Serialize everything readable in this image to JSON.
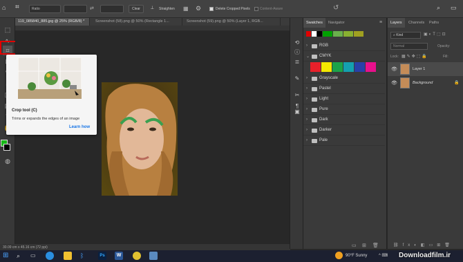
{
  "options_bar": {
    "ratio_label": "Ratio",
    "clear_label": "Clear",
    "straighten_label": "Straighten",
    "delete_cropped_label": "Delete Cropped Pixels",
    "content_aware_label": "Content-Aware"
  },
  "tabs": [
    {
      "label": "119_085840_885.jpg @ 25% (RGB/8) *",
      "active": true
    },
    {
      "label": "Screenshot (58).png @ 50% (Rectangle 1...",
      "active": false
    },
    {
      "label": "Screenshot (59).png @ 50% (Layer 1, RGB...",
      "active": false
    }
  ],
  "tooltip": {
    "title": "Crop tool (C)",
    "description": "Trims or expands the edges of an image",
    "link": "Learn how"
  },
  "status_bar": {
    "text": "30.09 cm x 45.16 cm (72 ppi)"
  },
  "swatches_panel": {
    "tabs": [
      "Swatches",
      "Navigator"
    ],
    "top_colors": [
      "#e00000",
      "#ffffff",
      "#000000",
      "#00a000",
      "#6ab04c",
      "#88b030",
      "#a0a020"
    ],
    "groups": [
      {
        "label": "RGB",
        "expanded": false
      },
      {
        "label": "CMYK",
        "expanded": true
      },
      {
        "label": "Grayscale",
        "expanded": false
      },
      {
        "label": "Pastel",
        "expanded": false
      },
      {
        "label": "Light",
        "expanded": false
      },
      {
        "label": "Pure",
        "expanded": false
      },
      {
        "label": "Dark",
        "expanded": false
      },
      {
        "label": "Darker",
        "expanded": false
      },
      {
        "label": "Pale",
        "expanded": false
      }
    ],
    "cmyk_colors": [
      "#e8202a",
      "#f4e800",
      "#1ca34a",
      "#14a0b0",
      "#2840a8",
      "#e8108c"
    ]
  },
  "layers_panel": {
    "tabs": [
      "Layers",
      "Channels",
      "Paths"
    ],
    "kind_label": "Kind",
    "blend_mode": "Normal",
    "opacity_label": "Opacity:",
    "lock_label": "Lock:",
    "fill_label": "Fill:",
    "layers": [
      {
        "name": "Layer 1",
        "italic": false
      },
      {
        "name": "Background",
        "italic": true
      }
    ]
  },
  "taskbar": {
    "weather": "90°F  Sunny"
  },
  "watermark": "Downloadfilm.ir",
  "colors": {
    "accent_red": "#e00000",
    "panel_bg": "#3a3a3a",
    "link_blue": "#1473e6"
  }
}
